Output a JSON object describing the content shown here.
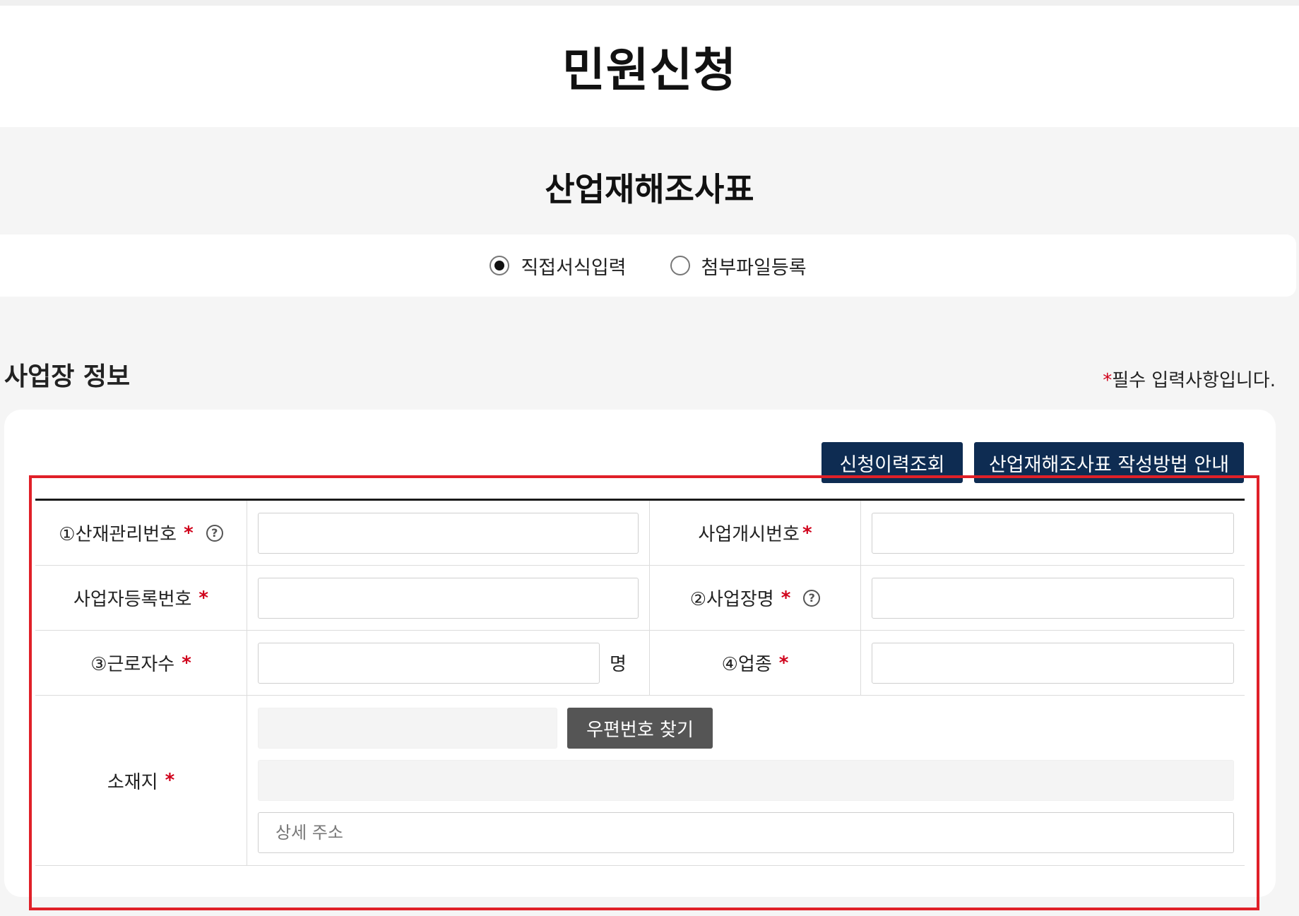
{
  "page": {
    "title": "민원신청",
    "form_title": "산업재해조사표"
  },
  "input_mode": {
    "options": [
      {
        "label": "직접서식입력",
        "selected": true
      },
      {
        "label": "첨부파일등록",
        "selected": false
      }
    ]
  },
  "section": {
    "title": "사업장 정보",
    "required_star": "*",
    "required_note": "필수 입력사항입니다."
  },
  "buttons": {
    "history": "신청이력조회",
    "guide": "산업재해조사표 작성방법 안내",
    "zip_search": "우편번호 찾기"
  },
  "fields": {
    "accident_mgmt_no": {
      "label": "①산재관리번호",
      "star": "*",
      "help": "?",
      "value": ""
    },
    "business_start_no": {
      "label": "사업개시번호",
      "star": "*",
      "value": ""
    },
    "business_reg_no": {
      "label": "사업자등록번호",
      "star": "*",
      "value": ""
    },
    "workplace_name": {
      "label": "②사업장명",
      "star": "*",
      "help": "?",
      "value": ""
    },
    "worker_count": {
      "label": "③근로자수",
      "star": "*",
      "unit": "명",
      "value": ""
    },
    "industry": {
      "label": "④업종",
      "star": "*",
      "value": ""
    },
    "location": {
      "label": "소재지",
      "star": "*",
      "detail_placeholder": "상세 주소"
    }
  },
  "colors": {
    "navy_button": "#0e2c52",
    "zip_button": "#555555",
    "required_star": "#d0021b",
    "highlight_frame": "#e02028"
  }
}
